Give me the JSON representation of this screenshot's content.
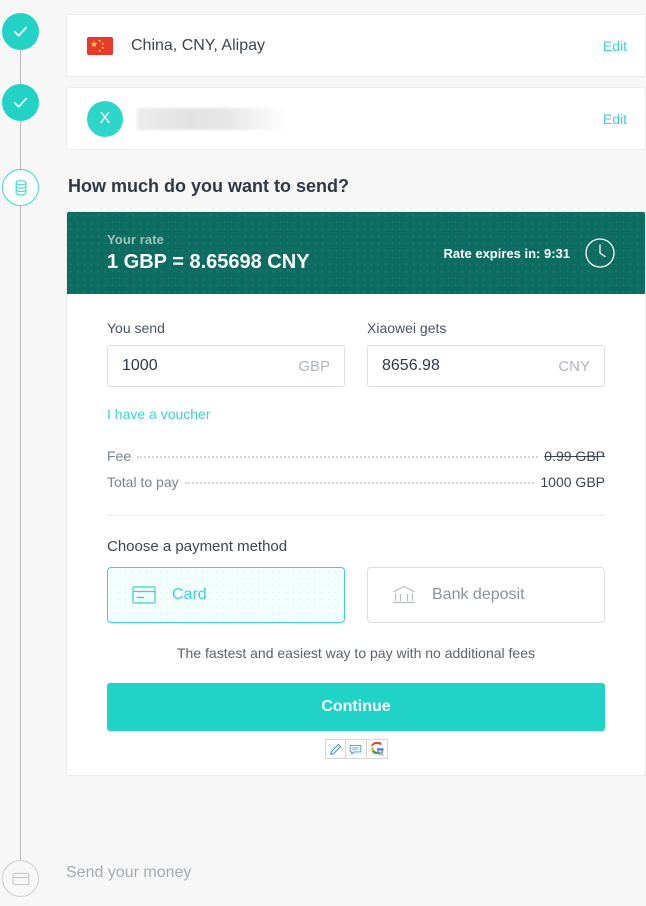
{
  "theme": {
    "accent": "#3ed2c7",
    "accent_button": "#1fd3c6",
    "banner_bg": "#0c6c62",
    "page_bg": "#f7f7f7",
    "text_dark": "#3c444f",
    "text_muted": "#7a828c"
  },
  "stepper": {
    "steps": [
      {
        "name": "recipient-country-step",
        "state": "done",
        "icon": "check-icon"
      },
      {
        "name": "recipient-step",
        "state": "done",
        "icon": "check-icon"
      },
      {
        "name": "amount-step",
        "state": "current",
        "icon": "coins-icon"
      },
      {
        "name": "send-money-step",
        "state": "pending",
        "icon": "card-icon",
        "label": "Send your money"
      }
    ]
  },
  "summary": {
    "country_row": {
      "flag": "china-flag-icon",
      "text": "China, CNY, Alipay",
      "edit_label": "Edit"
    },
    "recipient_row": {
      "avatar_initial": "X",
      "name_redacted": true,
      "edit_label": "Edit"
    }
  },
  "heading": "How much do you want to send?",
  "rate": {
    "label": "Your rate",
    "value": "1 GBP = 8.65698 CNY",
    "expiry_label": "Rate expires in: 9:31",
    "clock_icon": "clock-icon"
  },
  "amount": {
    "send": {
      "label": "You send",
      "value": "1000",
      "placeholder": "0",
      "currency": "GBP"
    },
    "receive": {
      "label": "Xiaowei gets",
      "value": "8656.98",
      "placeholder": "0",
      "currency": "CNY"
    },
    "voucher_link": "I have a voucher"
  },
  "fees": {
    "rows": [
      {
        "name": "Fee",
        "value": "0.99 GBP",
        "struck": true
      },
      {
        "name": "Total to pay",
        "value": "1000 GBP",
        "struck": false
      }
    ]
  },
  "payment": {
    "title": "Choose a payment method",
    "options": [
      {
        "label": "Card",
        "icon": "credit-card-icon",
        "selected": true
      },
      {
        "label": "Bank deposit",
        "icon": "bank-building-icon",
        "selected": false
      }
    ],
    "note": "The fastest and easiest way to pay with no additional fees"
  },
  "continue_label": "Continue",
  "extension_bar": {
    "buttons": [
      {
        "icon": "pen-icon"
      },
      {
        "icon": "comment-icon"
      },
      {
        "icon": "google-search-icon"
      }
    ]
  }
}
